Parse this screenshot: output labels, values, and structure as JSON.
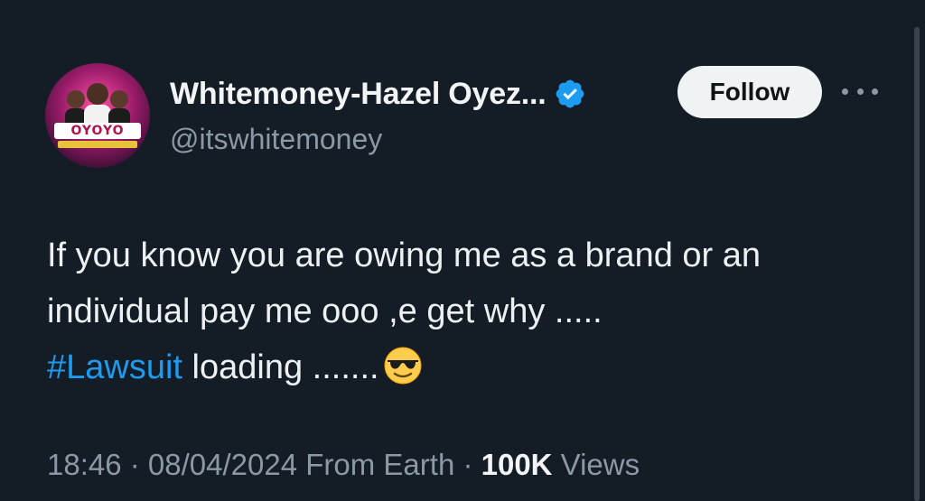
{
  "author": {
    "display_name": "Whitemoney-Hazel Oyez...",
    "handle": "@itswhitemoney",
    "verified_icon": "verified-badge-icon",
    "avatar_text": "OYOYO"
  },
  "actions": {
    "follow_label": "Follow",
    "more_icon": "more-options-icon"
  },
  "tweet": {
    "line1": "If you know you are owing me as a brand or an",
    "line2": "individual pay me ooo ,e get why .....",
    "hashtag": "#Lawsuit",
    "line3_rest": " loading .......",
    "emoji": "smiling-face-with-sunglasses"
  },
  "meta": {
    "time": "18:46",
    "sep1": " · ",
    "date": "08/04/2024",
    "source": " From Earth",
    "sep2": " · ",
    "views_count": "100K",
    "views_label": " Views"
  },
  "colors": {
    "background": "#141d26",
    "hashtag": "#1d9bf0",
    "verified": "#1d9bf0",
    "secondary_text": "#8b98a5"
  }
}
